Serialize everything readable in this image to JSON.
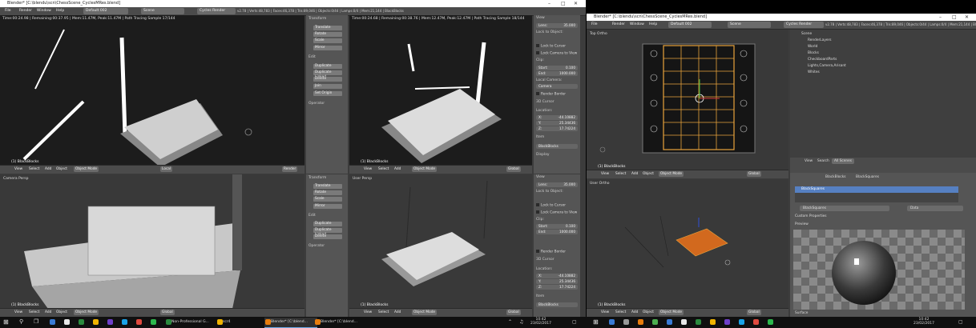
{
  "left_window": {
    "title": "Blender* [C:\\blendu\\scn\\ChessScene_CyclesMRes.blend]",
    "menus": [
      "File",
      "Render",
      "Window",
      "Help"
    ],
    "layout": "Default 002",
    "scene": "Scene",
    "engine": "Cycles Render",
    "stats": "v2.78 | Verts:48,783 | Faces:46,378 | Tris:89,046 | Objects:0/44 | Lamps:0/4 | Mem:21,144 | BlackBlocks",
    "tl_status": "Time:00:24.98 | Remaining:00:37.95 | Mem:11.47M, Peak:11.47M | Path Tracing Sample 17/144",
    "tr_status": "Time:00:24.68 | Remaining:00:38.76 | Mem:12.47M, Peak:12.47M | Path Tracing Sample 18/144",
    "tl_object": "(1) BlackBlocks",
    "tr_object": "(1) BlackBlocks",
    "bl_label": "Camera Persp",
    "bl_object": "(1) BlackBlocks",
    "br_label": "User Persp",
    "br_object": "(1) BlackBlocks",
    "header": {
      "view": "View",
      "select": "Select",
      "add": "Add",
      "object": "Object",
      "mode": "Object Mode",
      "pivot": "Local",
      "global": "Global",
      "render_btn": "Render"
    },
    "tools": {
      "transform": "Transform",
      "translate": "Translate",
      "rotate": "Rotate",
      "scale": "Scale",
      "mirror": "Mirror",
      "edit": "Edit",
      "duplicate": "Duplicate",
      "duplicate_linked": "Duplicate Linked",
      "delete": "Delete",
      "join": "Join",
      "set_origin": "Set Origin",
      "operator": "Operator"
    },
    "npanel": {
      "view": "View",
      "lens_label": "Lens:",
      "lens": "35.000",
      "lock_to_object": "Lock to Object:",
      "lock_to_cursor": "Lock to Cursor",
      "lock_camera": "Lock Camera to View",
      "clip": "Clip:",
      "start_label": "Start:",
      "start": "0.100",
      "end_label": "End:",
      "end": "1000.000",
      "local_camera": "Local Camera:",
      "camera": "Camera",
      "render_border": "Render Border",
      "cursor": "3D Cursor",
      "location": "Location:",
      "x_label": "X:",
      "x": "-44.10882",
      "y_label": "Y:",
      "y": "25.34436",
      "z_label": "Z:",
      "z": "17.74224",
      "item": "Item",
      "item_name": "BlackBlocks",
      "display": "Display"
    }
  },
  "right_window": {
    "title": "Blender* [C:\\blendu\\scn\\ChessScene_CyclesMRes.blend]",
    "menus": [
      "File",
      "Render",
      "Window",
      "Help"
    ],
    "layout": "Default 002",
    "scene": "Scene",
    "engine": "Cycles Render",
    "stats": "v2.78 | Verts:48,783 | Faces:46,378 | Tris:89,046 | Objects:0/44 | Lamps:0/4 | Mem:21,144 | BlackBlocks",
    "top_label": "Top Ortho",
    "top_object": "(1) BlackBlocks",
    "bottom_label": "User Ortho",
    "bottom_object": "(1) BlackBlocks",
    "header": {
      "view": "View",
      "select": "Select",
      "add": "Add",
      "object": "Object",
      "mode": "Object Mode",
      "global": "Global"
    },
    "outliner": {
      "view": "View",
      "search": "Search",
      "scenes": "All Scenes",
      "items": [
        "Scene",
        "RenderLayers",
        "World",
        "Blocks",
        "CheckboardParts",
        "Lights,Camera,Arisant",
        "Whites"
      ]
    },
    "properties": {
      "breadcrumb": "BlackBlocks",
      "breadcrumb2": "BlackSquares",
      "material": "BlackSquares",
      "datablock": "BlackSquares",
      "data": "Data",
      "custom_props": "Custom Properties",
      "preview": "Preview",
      "surface": "Surface"
    }
  },
  "taskbar": {
    "apps": [
      {
        "label": "Non-Professional G...",
        "color": "#2b8a3e"
      },
      {
        "label": "scr4",
        "color": "#f0b400"
      },
      {
        "label": "Blender* [C:\\blend...",
        "color": "#e87d0d"
      },
      {
        "label": "Blender* [C:\\blend...",
        "color": "#e87d0d"
      }
    ],
    "pinned_colors": [
      "#3a7bd5",
      "#e8e8e8",
      "#2b8a3e",
      "#f0b400",
      "#6e40c9",
      "#1aa3e8",
      "#e04a3f",
      "#2db84d",
      "#3a7bd5",
      "#999999",
      "#e87d0d",
      "#4caf50"
    ],
    "time": "10:42",
    "date": "23/02/2017"
  }
}
